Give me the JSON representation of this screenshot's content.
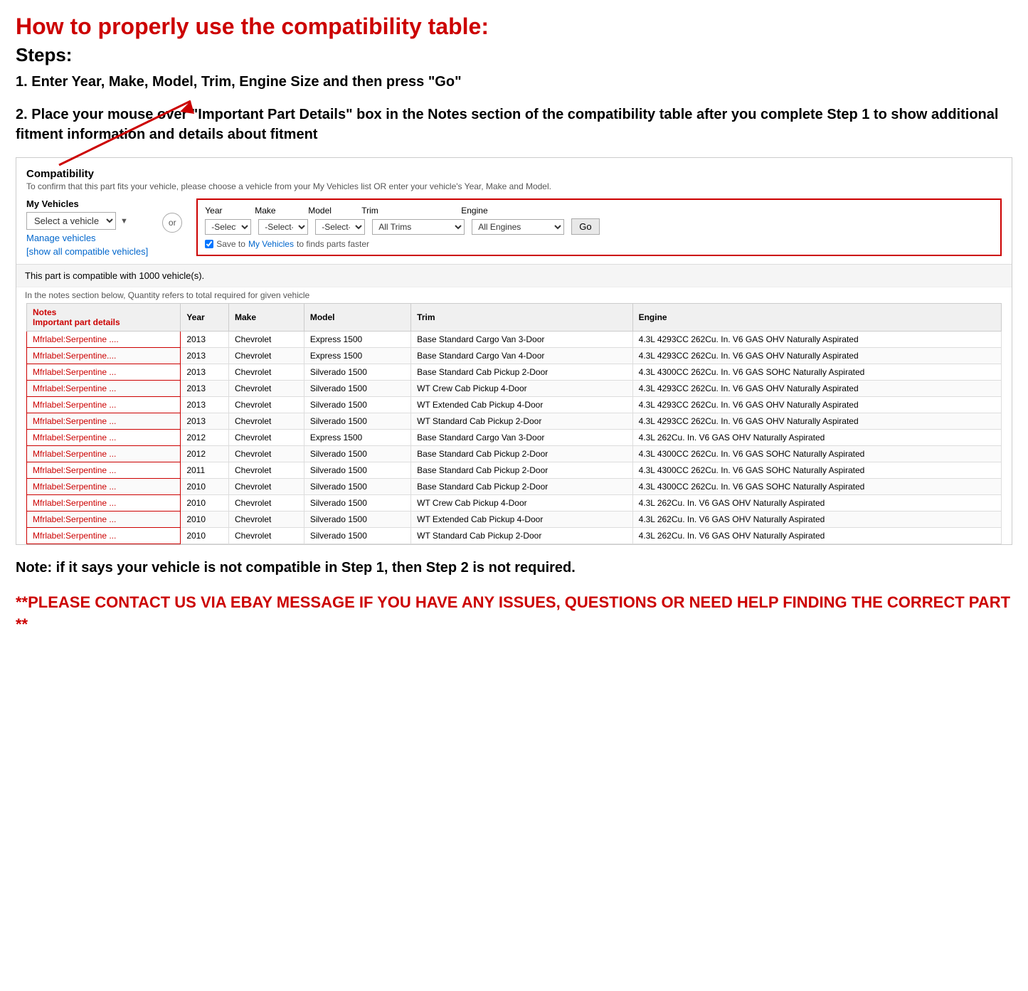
{
  "page": {
    "main_title": "How to properly use the compatibility table:",
    "steps_heading": "Steps:",
    "step1": "1. Enter Year, Make, Model, Trim, Engine Size and then press \"Go\"",
    "step2": "2. Place your mouse over \"Important Part Details\" box in the Notes section of the compatibility table after you complete Step 1 to show additional fitment information and details about fitment",
    "note_text": "Note: if it says your vehicle is not compatible in Step 1, then Step 2 is not required.",
    "contact_text": "**PLEASE CONTACT US VIA EBAY MESSAGE IF YOU HAVE ANY ISSUES, QUESTIONS OR NEED HELP FINDING THE CORRECT PART **"
  },
  "compatibility": {
    "section_title": "Compatibility",
    "subtitle": "To confirm that this part fits your vehicle, please choose a vehicle from your My Vehicles list OR enter your vehicle's Year, Make and Model.",
    "my_vehicles_label": "My Vehicles",
    "select_vehicle_placeholder": "Select a vehicle",
    "manage_vehicles_link": "Manage vehicles",
    "show_compat_link": "[show all compatible vehicles]",
    "or_label": "or",
    "year_label": "Year",
    "make_label": "Make",
    "model_label": "Model",
    "trim_label": "Trim",
    "engine_label": "Engine",
    "year_placeholder": "-Select-",
    "make_placeholder": "-Select-",
    "model_placeholder": "-Select-",
    "trim_value": "All Trims",
    "engine_value": "All Engines",
    "go_button": "Go",
    "save_checkbox_label": "Save to",
    "save_link_text": "My Vehicles",
    "save_suffix": "to finds parts faster",
    "compat_count": "This part is compatible with 1000 vehicle(s).",
    "compat_note": "In the notes section below, Quantity refers to total required for given vehicle",
    "table_headers": {
      "notes": "Notes",
      "notes_sub": "Important part details",
      "year": "Year",
      "make": "Make",
      "model": "Model",
      "trim": "Trim",
      "engine": "Engine"
    },
    "table_rows": [
      {
        "notes": "Mfrlabel:Serpentine ....",
        "year": "2013",
        "make": "Chevrolet",
        "model": "Express 1500",
        "trim": "Base Standard Cargo Van 3-Door",
        "engine": "4.3L 4293CC 262Cu. In. V6 GAS OHV Naturally Aspirated"
      },
      {
        "notes": "Mfrlabel:Serpentine....",
        "year": "2013",
        "make": "Chevrolet",
        "model": "Express 1500",
        "trim": "Base Standard Cargo Van 4-Door",
        "engine": "4.3L 4293CC 262Cu. In. V6 GAS OHV Naturally Aspirated"
      },
      {
        "notes": "Mfrlabel:Serpentine ...",
        "year": "2013",
        "make": "Chevrolet",
        "model": "Silverado 1500",
        "trim": "Base Standard Cab Pickup 2-Door",
        "engine": "4.3L 4300CC 262Cu. In. V6 GAS SOHC Naturally Aspirated"
      },
      {
        "notes": "Mfrlabel:Serpentine ...",
        "year": "2013",
        "make": "Chevrolet",
        "model": "Silverado 1500",
        "trim": "WT Crew Cab Pickup 4-Door",
        "engine": "4.3L 4293CC 262Cu. In. V6 GAS OHV Naturally Aspirated"
      },
      {
        "notes": "Mfrlabel:Serpentine ...",
        "year": "2013",
        "make": "Chevrolet",
        "model": "Silverado 1500",
        "trim": "WT Extended Cab Pickup 4-Door",
        "engine": "4.3L 4293CC 262Cu. In. V6 GAS OHV Naturally Aspirated"
      },
      {
        "notes": "Mfrlabel:Serpentine ...",
        "year": "2013",
        "make": "Chevrolet",
        "model": "Silverado 1500",
        "trim": "WT Standard Cab Pickup 2-Door",
        "engine": "4.3L 4293CC 262Cu. In. V6 GAS OHV Naturally Aspirated"
      },
      {
        "notes": "Mfrlabel:Serpentine ...",
        "year": "2012",
        "make": "Chevrolet",
        "model": "Express 1500",
        "trim": "Base Standard Cargo Van 3-Door",
        "engine": "4.3L 262Cu. In. V6 GAS OHV Naturally Aspirated"
      },
      {
        "notes": "Mfrlabel:Serpentine ...",
        "year": "2012",
        "make": "Chevrolet",
        "model": "Silverado 1500",
        "trim": "Base Standard Cab Pickup 2-Door",
        "engine": "4.3L 4300CC 262Cu. In. V6 GAS SOHC Naturally Aspirated"
      },
      {
        "notes": "Mfrlabel:Serpentine ...",
        "year": "2011",
        "make": "Chevrolet",
        "model": "Silverado 1500",
        "trim": "Base Standard Cab Pickup 2-Door",
        "engine": "4.3L 4300CC 262Cu. In. V6 GAS SOHC Naturally Aspirated"
      },
      {
        "notes": "Mfrlabel:Serpentine ...",
        "year": "2010",
        "make": "Chevrolet",
        "model": "Silverado 1500",
        "trim": "Base Standard Cab Pickup 2-Door",
        "engine": "4.3L 4300CC 262Cu. In. V6 GAS SOHC Naturally Aspirated"
      },
      {
        "notes": "Mfrlabel:Serpentine ...",
        "year": "2010",
        "make": "Chevrolet",
        "model": "Silverado 1500",
        "trim": "WT Crew Cab Pickup 4-Door",
        "engine": "4.3L 262Cu. In. V6 GAS OHV Naturally Aspirated"
      },
      {
        "notes": "Mfrlabel:Serpentine ...",
        "year": "2010",
        "make": "Chevrolet",
        "model": "Silverado 1500",
        "trim": "WT Extended Cab Pickup 4-Door",
        "engine": "4.3L 262Cu. In. V6 GAS OHV Naturally Aspirated"
      },
      {
        "notes": "Mfrlabel:Serpentine ...",
        "year": "2010",
        "make": "Chevrolet",
        "model": "Silverado 1500",
        "trim": "WT Standard Cab Pickup 2-Door",
        "engine": "4.3L 262Cu. In. V6 GAS OHV Naturally Aspirated"
      }
    ]
  }
}
